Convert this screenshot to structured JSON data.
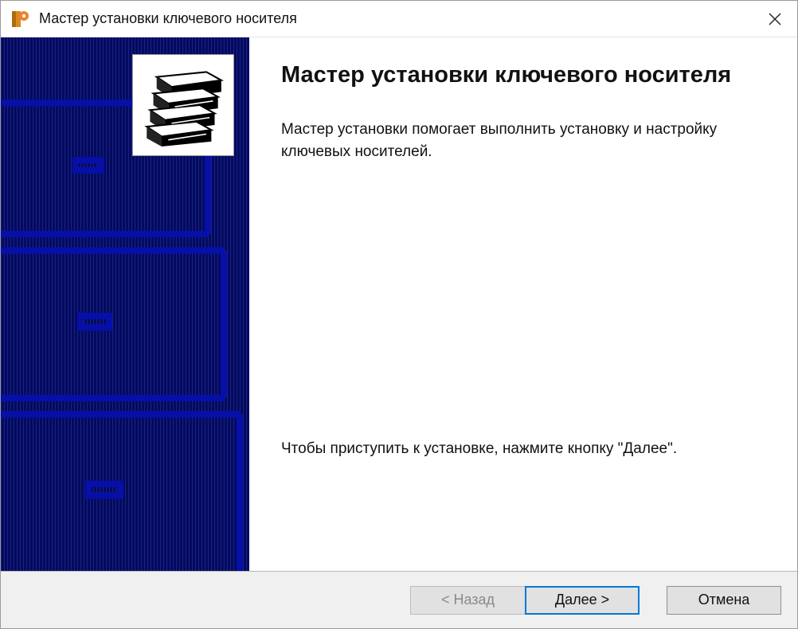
{
  "window": {
    "title": "Мастер установки ключевого носителя"
  },
  "main": {
    "heading": "Мастер установки ключевого носителя",
    "description": "Мастер установки помогает выполнить установку и настройку ключевых носителей.",
    "instruction": "Чтобы приступить к установке, нажмите кнопку \"Далее\"."
  },
  "buttons": {
    "back": "< Назад",
    "next": "Далее >",
    "cancel": "Отмена"
  },
  "colors": {
    "banner_bg": "#030a5f",
    "accent": "#0078d7"
  }
}
